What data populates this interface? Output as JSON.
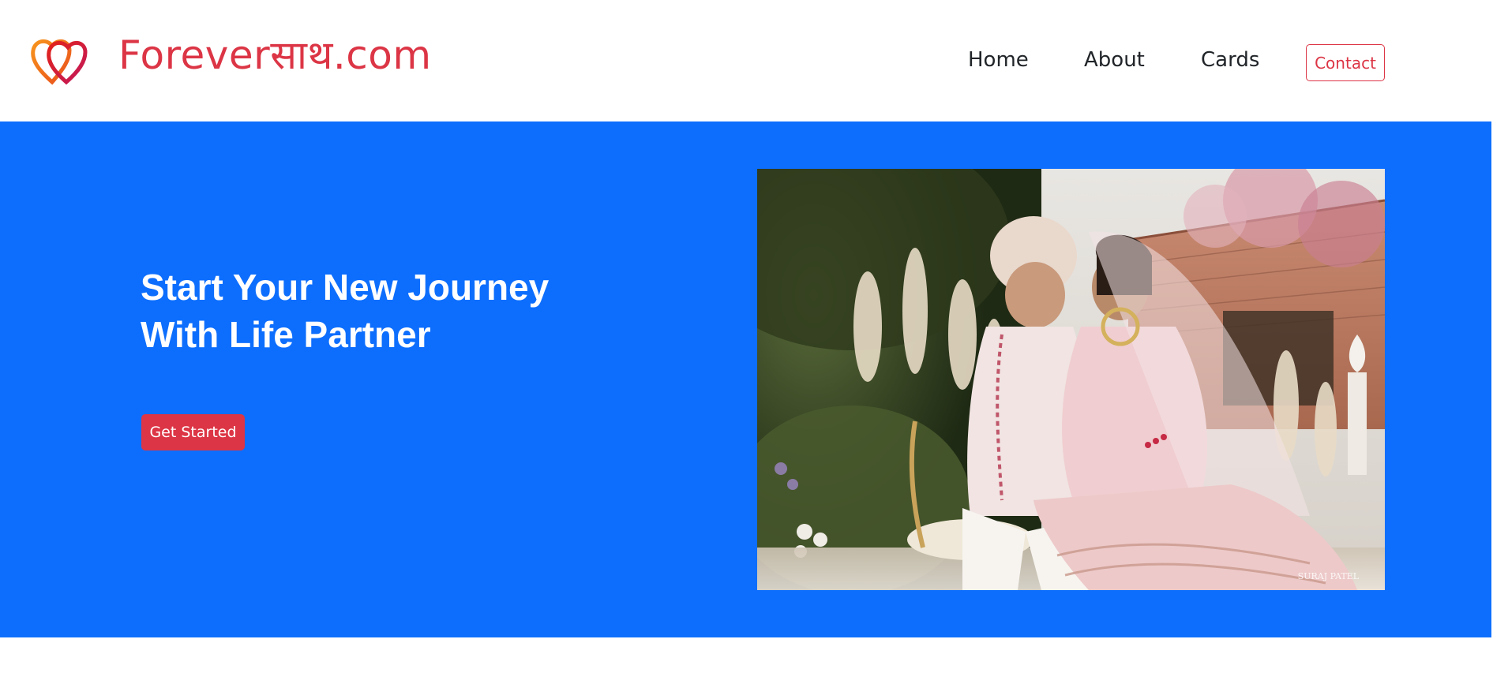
{
  "brand": {
    "name": "Foreverसाथ.com",
    "logo_icon": "double-heart-icon",
    "colors": {
      "primary": "#dc3545",
      "secondary": "#f7941d"
    }
  },
  "nav": {
    "items": [
      {
        "label": "Home"
      },
      {
        "label": "About"
      },
      {
        "label": "Cards"
      }
    ],
    "contact_label": "Contact"
  },
  "hero": {
    "title_line1": "Start Your New Journey",
    "title_line2": "With Life Partner",
    "cta_label": "Get Started",
    "background_color": "#0d6efd",
    "image": {
      "subject": "wedding-couple-photo",
      "watermark": "SURAJ PATEL"
    }
  }
}
